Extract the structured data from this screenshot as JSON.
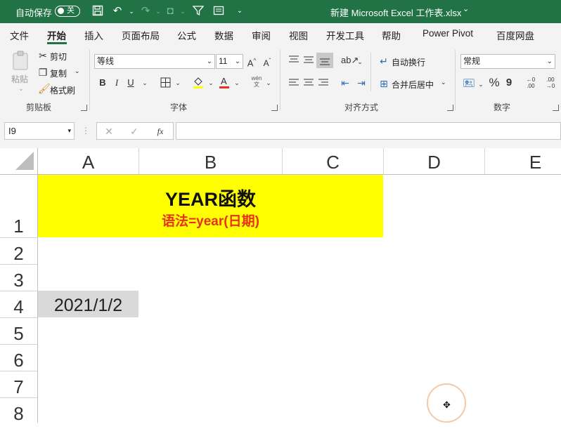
{
  "titlebar": {
    "autosave_label": "自动保存",
    "autosave_state": "关",
    "doc_title": "新建 Microsoft Excel 工作表.xlsx",
    "title_dropdown": "⌄"
  },
  "menu": {
    "tabs": [
      "文件",
      "开始",
      "插入",
      "页面布局",
      "公式",
      "数据",
      "审阅",
      "视图",
      "开发工具",
      "帮助",
      "Power Pivot",
      "百度网盘"
    ],
    "active_tab": "开始"
  },
  "ribbon": {
    "clipboard": {
      "paste": "粘贴",
      "cut": "剪切",
      "copy": "复制",
      "format_painter": "格式刷",
      "label": "剪贴板"
    },
    "font": {
      "font_name": "等线",
      "font_size": "11",
      "bold": "B",
      "italic": "I",
      "underline": "U",
      "label": "字体"
    },
    "alignment": {
      "wrap_text": "自动换行",
      "merge_center": "合并后居中",
      "label": "对齐方式"
    },
    "number": {
      "format": "常规",
      "percent": "%",
      "comma": "9",
      "label": "数字"
    }
  },
  "formula_bar": {
    "name_box": "I9",
    "fx": "fx",
    "formula": ""
  },
  "sheet": {
    "columns": [
      "A",
      "B",
      "C",
      "D",
      "E"
    ],
    "rows": [
      "1",
      "2",
      "3",
      "4",
      "5",
      "6",
      "7",
      "8"
    ],
    "title_main": "YEAR函数",
    "title_sub": "语法=year(日期)",
    "a4_value": "2021/1/2"
  },
  "colors": {
    "excel_green": "#217346",
    "title_fill": "#ffff00",
    "subtitle_red": "#e8321d",
    "selected_fill": "#d9d9d9"
  }
}
